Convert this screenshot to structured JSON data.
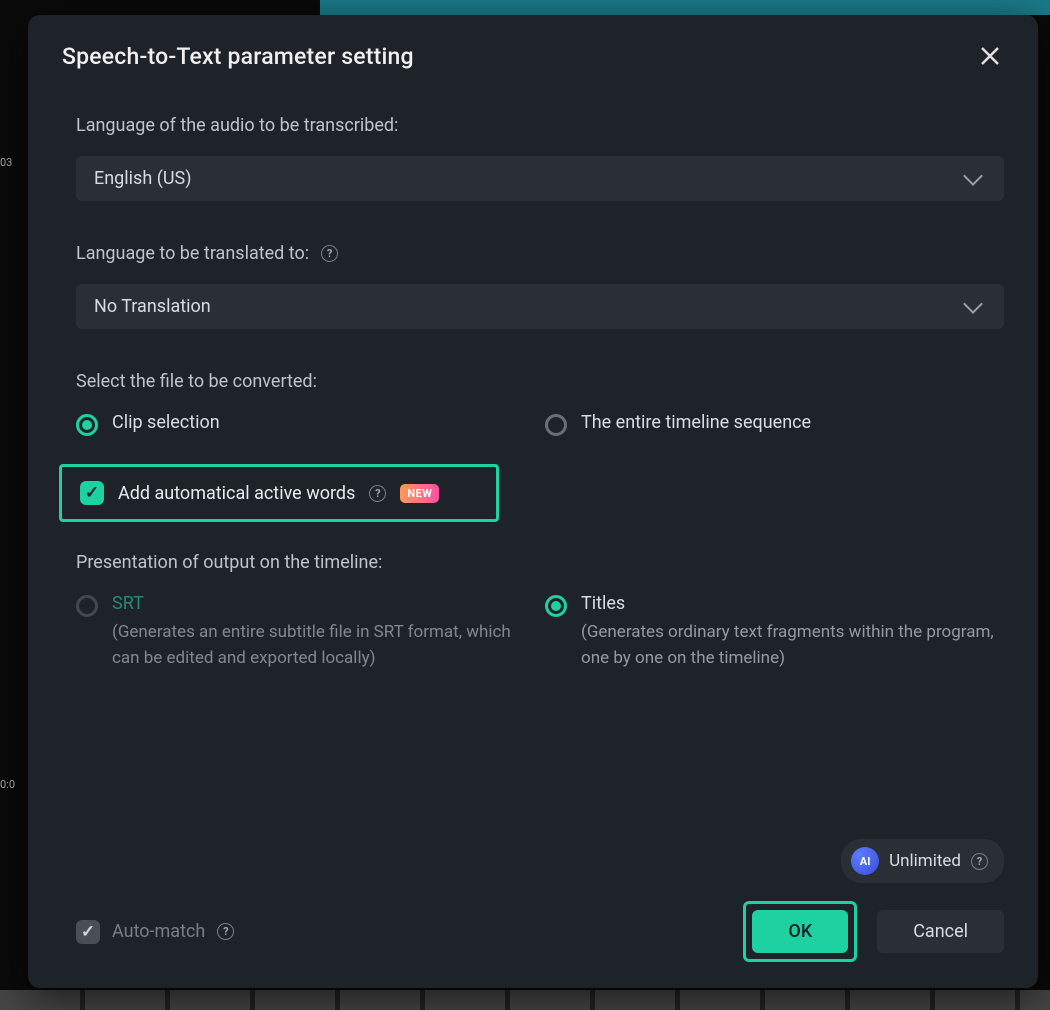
{
  "dialog": {
    "title": "Speech-to-Text parameter setting",
    "language_section": {
      "label": "Language of the audio to be transcribed:",
      "selected": "English (US)"
    },
    "translation_section": {
      "label": "Language to be translated to:",
      "selected": "No Translation"
    },
    "file_section": {
      "label": "Select the file to be converted:",
      "clip_selection": "Clip selection",
      "entire_timeline": "The entire timeline sequence"
    },
    "active_words": {
      "label": "Add automatical active words",
      "badge": "NEW"
    },
    "output_section": {
      "label": "Presentation of output on the timeline:",
      "srt": {
        "title": "SRT",
        "desc": "(Generates an entire subtitle file in SRT format, which can be edited and exported locally)"
      },
      "titles": {
        "title": "Titles",
        "desc": "(Generates ordinary text fragments within the program, one by one on the timeline)"
      }
    },
    "ai_credits": "Unlimited",
    "auto_match": "Auto-match",
    "ok_button": "OK",
    "cancel_button": "Cancel"
  },
  "bg": {
    "time1": "03",
    "time2": "0:0"
  }
}
